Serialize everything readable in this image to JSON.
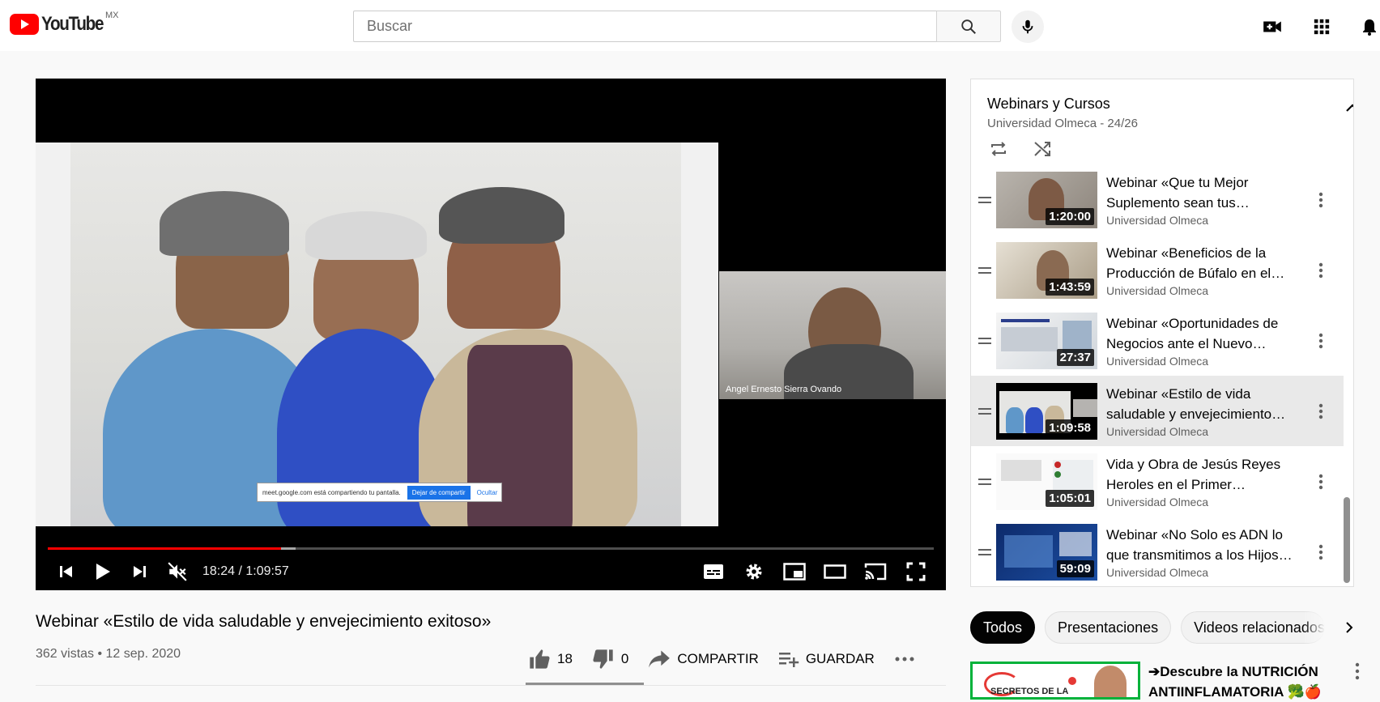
{
  "header": {
    "logo_text": "YouTube",
    "country": "MX",
    "search_placeholder": "Buscar"
  },
  "player": {
    "participant_name": "Angel Ernesto Sierra Ovando",
    "share_notice": "meet.google.com está compartiendo tu pantalla.",
    "stop_share_label": "Dejar de compartir",
    "hide_label": "Ocultar",
    "time_display": "18:24 / 1:09:57",
    "played_fraction": 0.263,
    "buffered_fraction": 0.28
  },
  "video": {
    "title": "Webinar «Estilo de vida saludable y envejecimiento exitoso»",
    "meta": "362 vistas • 12 sep. 2020",
    "likes": "18",
    "dislikes": "0",
    "share_label": "COMPARTIR",
    "save_label": "GUARDAR"
  },
  "playlist": {
    "title": "Webinars y Cursos",
    "subtitle": "Universidad Olmeca - 24/26",
    "items": [
      {
        "title": "Webinar «Que tu Mejor Suplemento sean tus…",
        "channel": "Universidad Olmeca",
        "duration": "1:20:00"
      },
      {
        "title": "Webinar «Beneficios de la Producción de Búfalo en el…",
        "channel": "Universidad Olmeca",
        "duration": "1:43:59"
      },
      {
        "title": "Webinar «Oportunidades de Negocios ante el Nuevo…",
        "channel": "Universidad Olmeca",
        "duration": "27:37"
      },
      {
        "title": "Webinar «Estilo de vida saludable y envejecimiento…",
        "channel": "Universidad Olmeca",
        "duration": "1:09:58"
      },
      {
        "title": "Vida y Obra de Jesús Reyes Heroles en el Primer…",
        "channel": "Universidad Olmeca",
        "duration": "1:05:01"
      },
      {
        "title": "Webinar «No Solo es ADN lo que transmitimos a los Hijos…",
        "channel": "Universidad Olmeca",
        "duration": "59:09"
      }
    ]
  },
  "chips": [
    "Todos",
    "Presentaciones",
    "Videos relacionados"
  ],
  "recommendation": {
    "title": "➔Descubre la NUTRICIÓN ANTIINFLAMATORIA 🥦🍎",
    "thumb_text": "SECRETOS DE LA"
  }
}
